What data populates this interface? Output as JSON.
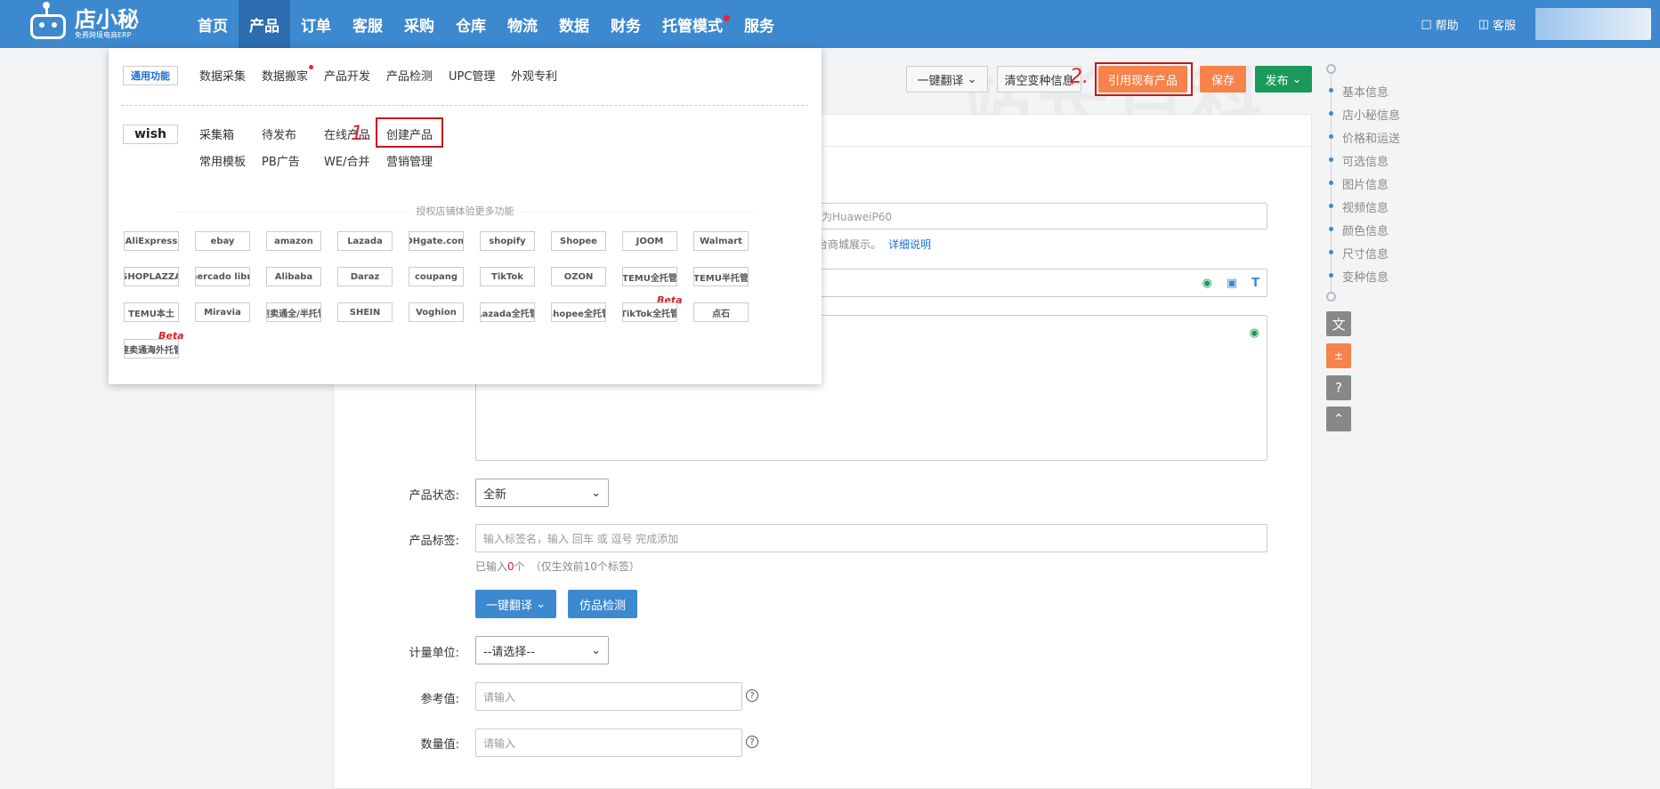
{
  "logo": {
    "title": "店小秘",
    "subtitle": "免费跨境电商ERP"
  },
  "nav": [
    {
      "label": "首页"
    },
    {
      "label": "产品"
    },
    {
      "label": "订单"
    },
    {
      "label": "客服"
    },
    {
      "label": "采购"
    },
    {
      "label": "仓库"
    },
    {
      "label": "物流"
    },
    {
      "label": "数据"
    },
    {
      "label": "财务"
    },
    {
      "label": "托管模式"
    },
    {
      "label": "服务"
    }
  ],
  "top_right": {
    "help": "帮助",
    "service": "客服"
  },
  "toolbar": {
    "translate": "一键翻译",
    "clear_variant": "清空变种信息",
    "cite_product": "引用现有产品",
    "save": "保存",
    "publish": "发布"
  },
  "annotations": {
    "step1": "1.",
    "step2": "2."
  },
  "toc": [
    "基本信息",
    "店小秘信息",
    "价格和运送",
    "可选信息",
    "图片信息",
    "视频信息",
    "颜色信息",
    "尺寸信息",
    "变种信息"
  ],
  "dropdown": {
    "general_tag": "通用功能",
    "general_links": [
      "数据采集",
      "数据搬家",
      "产品开发",
      "产品检测",
      "UPC管理",
      "外观专利"
    ],
    "wish_tag": "wish",
    "wish_row1": [
      "采集箱",
      "待发布",
      "在线产品",
      "创建产品"
    ],
    "wish_row2": [
      "常用模板",
      "PB广告",
      "WE/合并",
      "营销管理"
    ],
    "authorize_title": "授权店铺体验更多功能",
    "platforms_row1": [
      "AliExpress",
      "ebay",
      "amazon",
      "Lazada",
      "DHgate.com",
      "shopify",
      "Shopee",
      "JOOM",
      "Walmart"
    ],
    "platforms_row2": [
      "SHOPLAZZA",
      "mercado libre",
      "Alibaba",
      "Daraz",
      "coupang",
      "TikTok",
      "OZON",
      "TEMU全托管",
      "TEMU半托管"
    ],
    "platforms_row3": [
      "TEMU本土",
      "Miravia",
      "速卖通全/半托管",
      "SHEIN",
      "Voghion",
      "Lazada全托管",
      "Shopee全托管",
      "TikTok全托管",
      "点石"
    ],
    "platforms_row4": [
      "速卖通海外托管"
    ],
    "beta": "Beta"
  },
  "form": {
    "title_placeholder_tail": "为HuaweiP60",
    "title_hint": "台商城展示。",
    "detail_link": "详细说明",
    "status_label": "产品状态:",
    "status_value": "全新",
    "tags_label": "产品标签:",
    "tags_placeholder": "输入标签名，输入 回车 或 逗号 完成添加",
    "tags_count_prefix": "已输入",
    "tags_count": "0",
    "tags_count_suffix": "个　（仅生效前10个标签）",
    "translate_btn": "一键翻译",
    "detect_btn": "仿品检测",
    "unit_label": "计量单位:",
    "unit_value": "--请选择--",
    "ref_label": "参考值:",
    "ref_placeholder": "请输入",
    "qty_label": "数量值:",
    "qty_placeholder": "请输入"
  },
  "watermark": "站长百科",
  "colors": {
    "nav_bg": "#3d89cf",
    "accent_orange": "#f5834a",
    "publish_green": "#1a9a5a",
    "annotation_red": "#d7222a"
  }
}
